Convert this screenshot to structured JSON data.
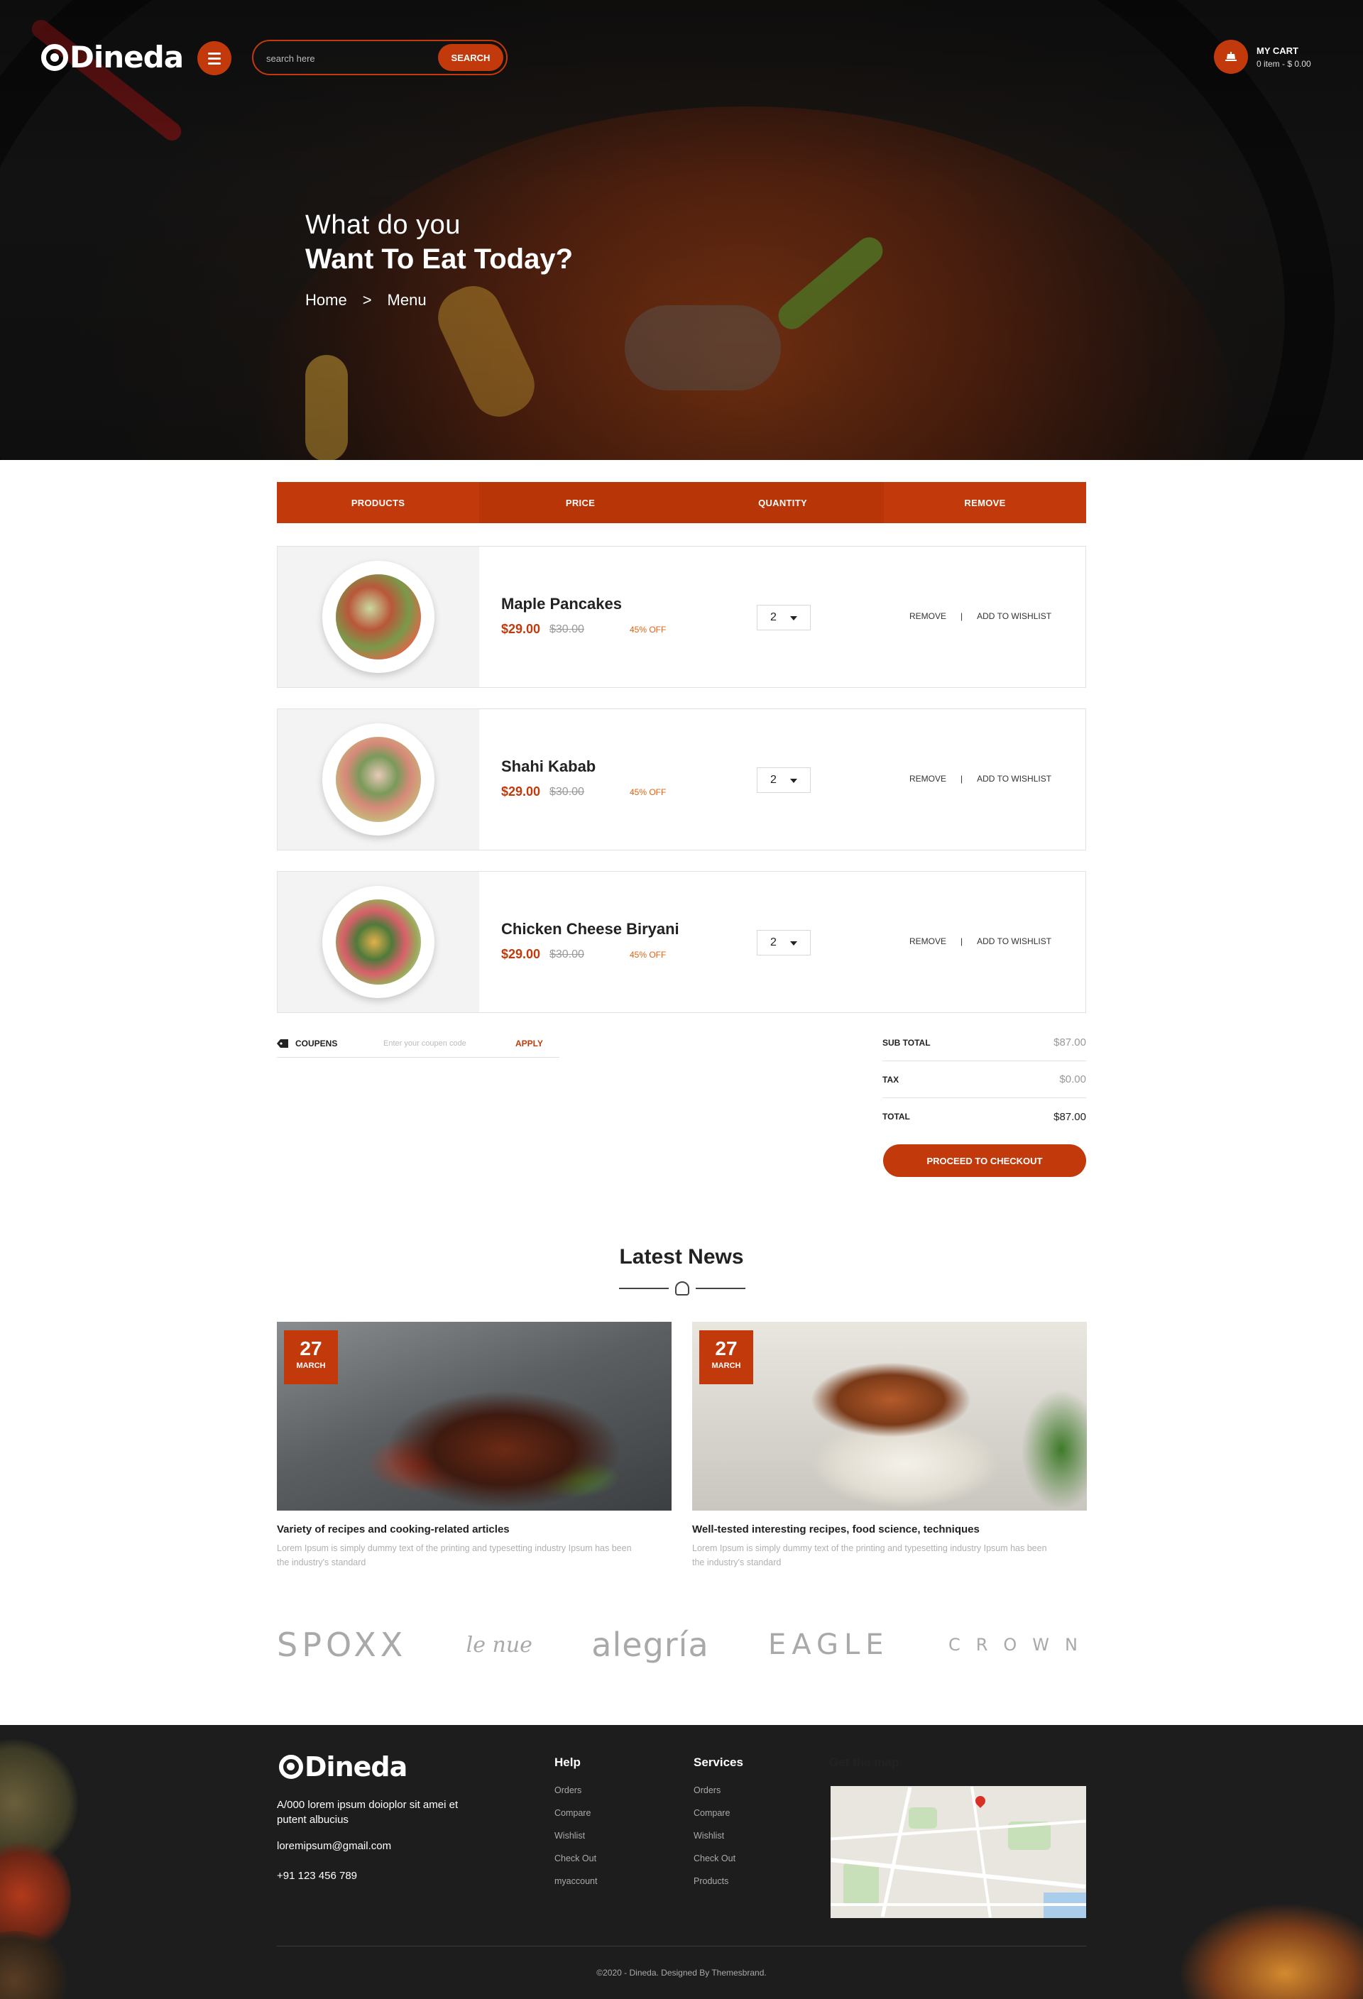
{
  "header": {
    "logo_text": "Dineda",
    "search": {
      "placeholder": "search here",
      "button_label": "SEARCH"
    },
    "cart": {
      "title": "MY CART",
      "summary": "0 item - $ 0.00"
    }
  },
  "hero": {
    "line1": "What do you",
    "line2": "Want To Eat Today?",
    "breadcrumb": [
      "Home",
      ">",
      "Menu"
    ]
  },
  "cart_table": {
    "headers": [
      "PRODUCTS",
      "PRICE",
      "QUANTITY",
      "REMOVE"
    ],
    "rows": [
      {
        "name": "Maple Pancakes",
        "price": "$29.00",
        "old_price": "$30.00",
        "discount": "45% OFF",
        "qty": "2",
        "remove": "REMOVE",
        "separator": "|",
        "wishlist": "ADD TO WISHLIST"
      },
      {
        "name": "Shahi Kabab",
        "price": "$29.00",
        "old_price": "$30.00",
        "discount": "45% OFF",
        "qty": "2",
        "remove": "REMOVE",
        "separator": "|",
        "wishlist": "ADD TO WISHLIST"
      },
      {
        "name": "Chicken Cheese Biryani",
        "price": "$29.00",
        "old_price": "$30.00",
        "discount": "45% OFF",
        "qty": "2",
        "remove": "REMOVE",
        "separator": "|",
        "wishlist": "ADD TO WISHLIST"
      }
    ]
  },
  "coupon": {
    "label": "COUPENS",
    "placeholder": "Enter your coupen code",
    "apply": "APPLY"
  },
  "totals": {
    "subtotal_label": "SUB TOTAL",
    "subtotal": "$87.00",
    "tax_label": "TAX",
    "tax": "$0.00",
    "total_label": "TOTAL",
    "total": "$87.00",
    "checkout": "PROCEED TO CHECKOUT"
  },
  "news": {
    "title": "Latest News",
    "cards": [
      {
        "day": "27",
        "month": "MARCH",
        "title": "Variety of recipes and cooking-related articles",
        "desc": "Lorem Ipsum is simply dummy text of the printing and typesetting industry Ipsum has been the industry's standard"
      },
      {
        "day": "27",
        "month": "MARCH",
        "title": "Well-tested interesting recipes, food science, techniques",
        "desc": "Lorem Ipsum is simply dummy text of the printing and typesetting industry Ipsum has been the industry's standard"
      }
    ]
  },
  "brands": [
    "SPOXX",
    "le nue",
    "alegría",
    "EAGLE",
    "CROWN"
  ],
  "footer": {
    "logo_text": "Dineda",
    "address": "A/000  lorem ipsum doioplor sit amei et putent albucius",
    "email": "loremipsum@gmail.com",
    "phone": "+91 123 456 789",
    "help": {
      "title": "Help",
      "links": [
        "Orders",
        "Compare",
        "Wishlist",
        "Check Out",
        "myaccount"
      ]
    },
    "services": {
      "title": "Services",
      "links": [
        "Orders",
        "Compare",
        "Wishlist",
        "Check Out",
        "Products"
      ]
    },
    "map_title": "Get the map",
    "copyright": "©2020 - Dineda. Designed By Themesbrand."
  },
  "colors": {
    "accent": "#c23a0c",
    "dark": "#1d1d1d"
  }
}
